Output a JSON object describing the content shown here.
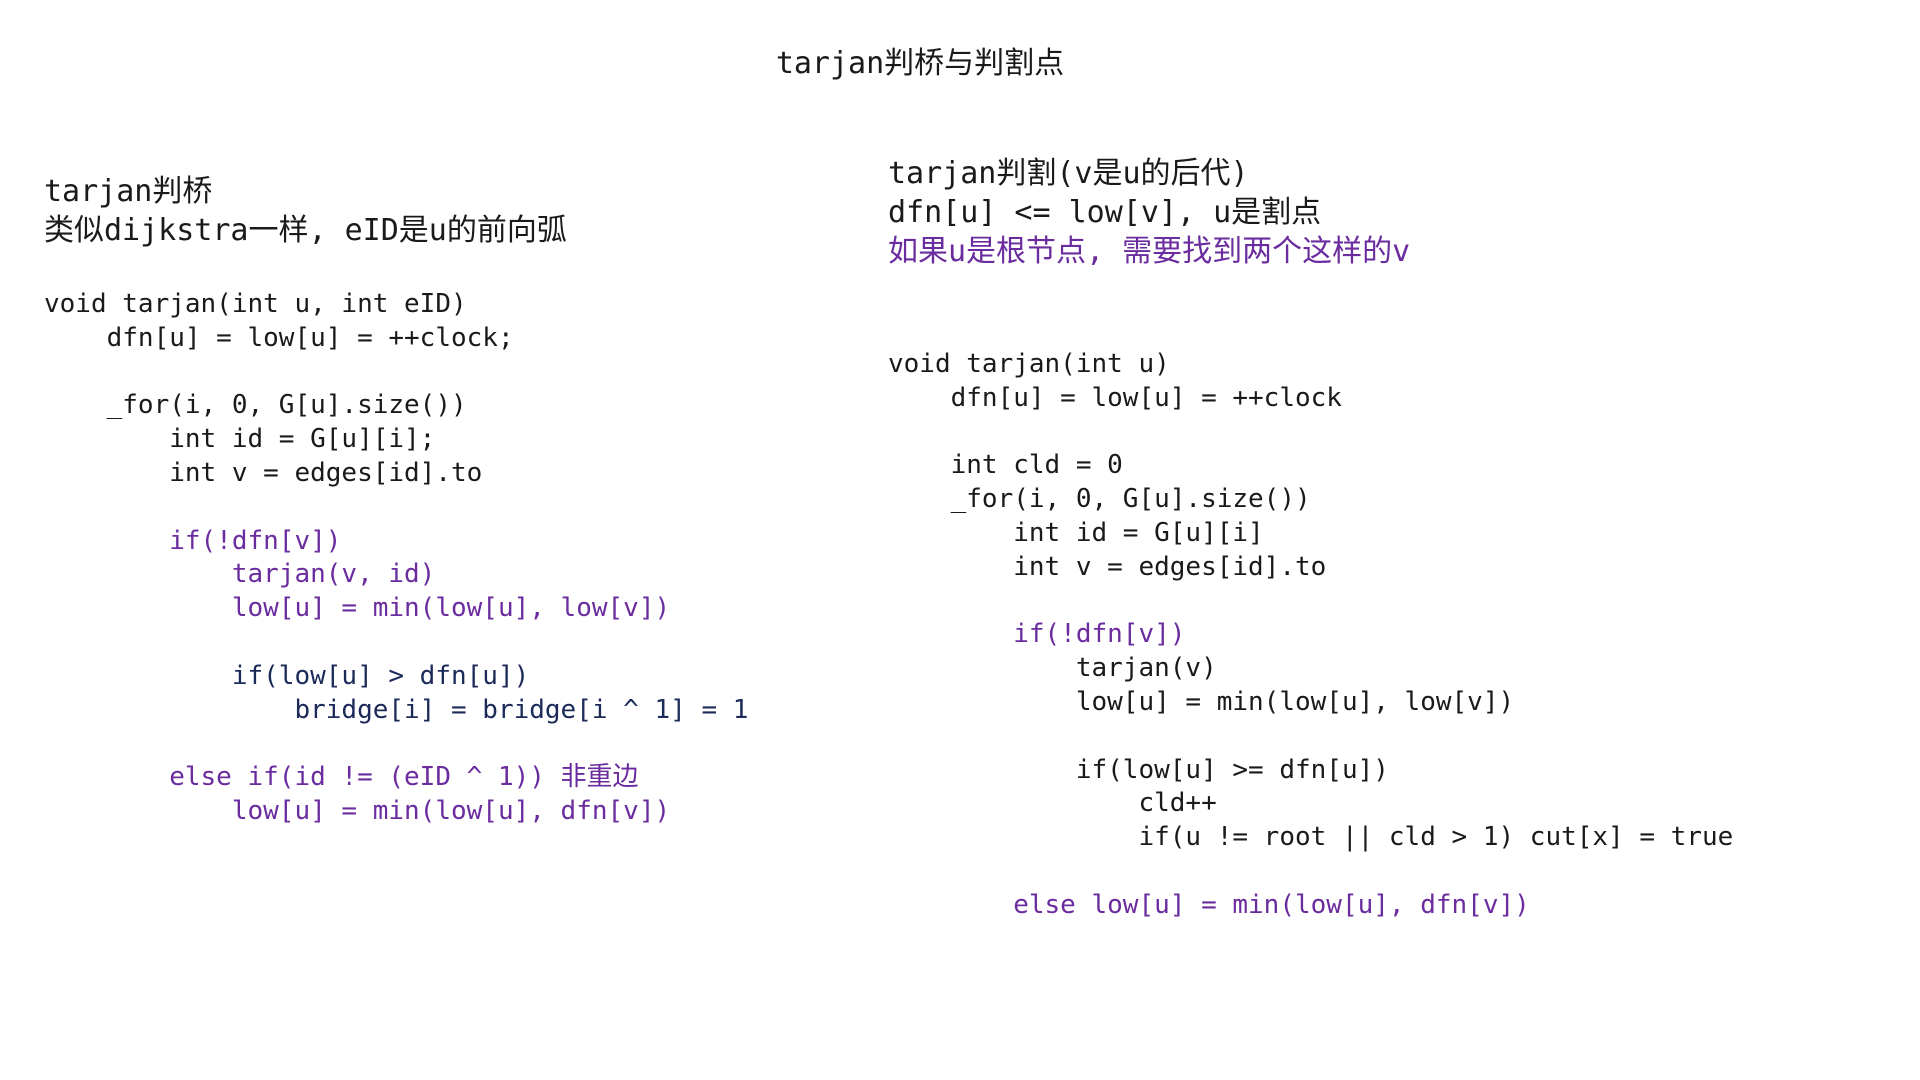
{
  "title": "tarjan判桥与判割点",
  "left": {
    "heading": [
      {
        "text": "tarjan判桥",
        "color": "black"
      },
      {
        "text": "类似dijkstra一样, eID是u的前向弧",
        "color": "black"
      }
    ],
    "code": [
      {
        "text": "void tarjan(int u, int eID)",
        "color": "black"
      },
      {
        "text": "    dfn[u] = low[u] = ++clock;",
        "color": "black"
      },
      {
        "text": "",
        "color": "black"
      },
      {
        "text": "    _for(i, 0, G[u].size())",
        "color": "black"
      },
      {
        "text": "        int id = G[u][i];",
        "color": "black"
      },
      {
        "text": "        int v = edges[id].to",
        "color": "black"
      },
      {
        "text": "",
        "color": "black"
      },
      {
        "text": "        if(!dfn[v])",
        "color": "purple"
      },
      {
        "text": "            tarjan(v, id)",
        "color": "purple"
      },
      {
        "text": "            low[u] = min(low[u], low[v])",
        "color": "purple"
      },
      {
        "text": "",
        "color": "black"
      },
      {
        "text": "            if(low[u] > dfn[u])",
        "color": "navy"
      },
      {
        "text": "                bridge[i] = bridge[i ^ 1] = 1",
        "color": "navy"
      },
      {
        "text": "",
        "color": "black"
      },
      {
        "text": "        else if(id != (eID ^ 1)) 非重边",
        "color": "purple"
      },
      {
        "text": "            low[u] = min(low[u], dfn[v])",
        "color": "purple"
      }
    ]
  },
  "right": {
    "heading": [
      {
        "text": "tarjan判割(v是u的后代)",
        "color": "black"
      },
      {
        "text": "dfn[u] <= low[v], u是割点",
        "color": "black"
      },
      {
        "text": "如果u是根节点, 需要找到两个这样的v",
        "color": "purple"
      }
    ],
    "code": [
      {
        "text": "void tarjan(int u)",
        "color": "black"
      },
      {
        "text": "    dfn[u] = low[u] = ++clock",
        "color": "black"
      },
      {
        "text": "",
        "color": "black"
      },
      {
        "text": "    int cld = 0",
        "color": "black"
      },
      {
        "text": "    _for(i, 0, G[u].size())",
        "color": "black"
      },
      {
        "text": "        int id = G[u][i]",
        "color": "black"
      },
      {
        "text": "        int v = edges[id].to",
        "color": "black"
      },
      {
        "text": "",
        "color": "black"
      },
      {
        "text": "        if(!dfn[v])",
        "color": "purple"
      },
      {
        "text": "            tarjan(v)",
        "color": "black"
      },
      {
        "text": "            low[u] = min(low[u], low[v])",
        "color": "black"
      },
      {
        "text": "",
        "color": "black"
      },
      {
        "text": "            if(low[u] >= dfn[u])",
        "color": "black"
      },
      {
        "text": "                cld++",
        "color": "black"
      },
      {
        "text": "                if(u != root || cld > 1) cut[x] = true",
        "color": "black"
      },
      {
        "text": "",
        "color": "black"
      },
      {
        "text": "        else low[u] = min(low[u], dfn[v])",
        "color": "purple"
      }
    ]
  },
  "colors": {
    "black": "#1a1a1a",
    "purple": "#6a2c9e",
    "navy": "#1c2a5a"
  }
}
